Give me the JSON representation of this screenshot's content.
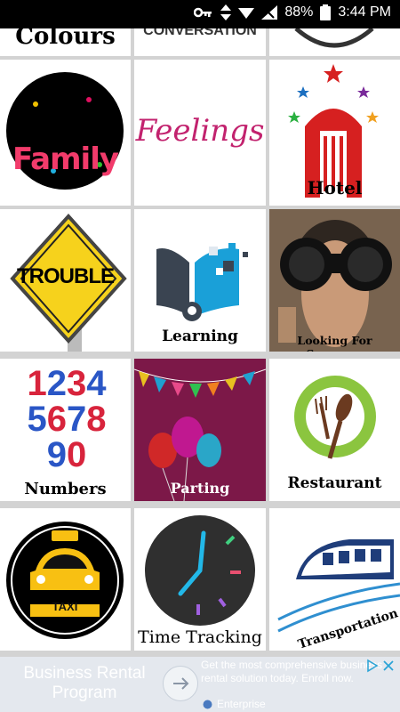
{
  "status_bar": {
    "battery": "88%",
    "time": "3:44 PM"
  },
  "tiles": [
    {
      "label": "Colours"
    },
    {
      "label": "CONVERSATION"
    },
    {
      "label": ""
    },
    {
      "label": "Family"
    },
    {
      "label": "Feelings"
    },
    {
      "label": "Hotel"
    },
    {
      "label": "TROUBLE"
    },
    {
      "label": "Learning"
    },
    {
      "label": "Looking For Someone"
    },
    {
      "label": "Numbers",
      "digits": [
        "1",
        "2",
        "3",
        "4",
        "5",
        "6",
        "7",
        "8",
        "9",
        "0"
      ]
    },
    {
      "label": "Parting"
    },
    {
      "label": "Restaurant"
    },
    {
      "label": "Time Tracking",
      "taxi_sign": "TAXI"
    },
    {
      "label": "Transportation"
    }
  ],
  "ad": {
    "title": "Business Rental Program",
    "body": "Get the most comprehensive business rental solution today. Enroll now.",
    "sponsor": "Enterprise"
  },
  "colors": {
    "ad_bg": "#e4e8ee",
    "status_bg": "#000000"
  }
}
